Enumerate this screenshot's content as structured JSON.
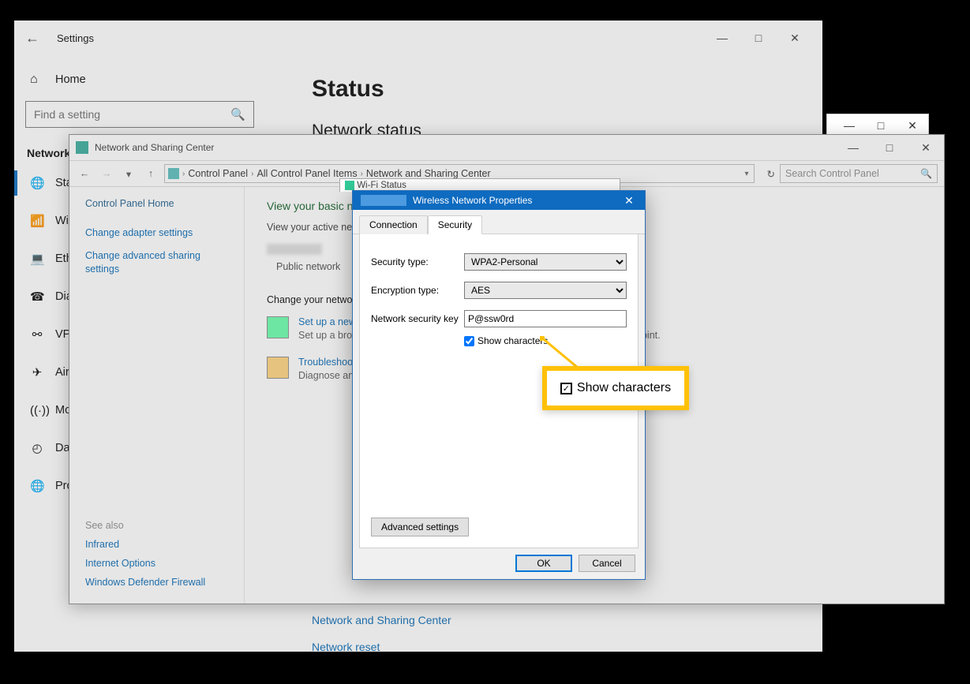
{
  "settings": {
    "window_title": "Settings",
    "home_label": "Home",
    "search_placeholder": "Find a setting",
    "section_title": "Network & Internet",
    "nav_items": [
      {
        "label": "Status",
        "active": true
      },
      {
        "label": "Wi-Fi"
      },
      {
        "label": "Ethernet"
      },
      {
        "label": "Dial-up"
      },
      {
        "label": "VPN"
      },
      {
        "label": "Airplane mode"
      },
      {
        "label": "Mobile hotspot"
      },
      {
        "label": "Data usage"
      },
      {
        "label": "Proxy"
      }
    ],
    "main_heading": "Status",
    "sub_heading": "Network status",
    "link_sharing": "Network and Sharing Center",
    "link_reset": "Network reset"
  },
  "control_panel": {
    "window_title": "Network and Sharing Center",
    "breadcrumb": [
      "Control Panel",
      "All Control Panel Items",
      "Network and Sharing Center"
    ],
    "search_placeholder": "Search Control Panel",
    "left": {
      "home": "Control Panel Home",
      "link1": "Change adapter settings",
      "link2": "Change advanced sharing settings",
      "see_also": "See also",
      "bottom": [
        "Infrared",
        "Internet Options",
        "Windows Defender Firewall"
      ]
    },
    "main": {
      "h1": "View your basic network information and set up connections",
      "sub1": "View your active networks",
      "net_type": "Public network",
      "change_title": "Change your networking settings",
      "task1_link": "Set up a new connection or network",
      "task1_desc": "Set up a broadband, dial-up, or VPN connection; or set up a router or access point.",
      "task2_link": "Troubleshoot problems",
      "task2_desc": "Diagnose and repair network problems, or get troubleshooting information."
    }
  },
  "wifi_status_peek": "Wi-Fi Status",
  "wnp": {
    "title": "Wireless Network Properties",
    "tabs": {
      "connection": "Connection",
      "security": "Security"
    },
    "lbl_sec_type": "Security type:",
    "val_sec_type": "WPA2-Personal",
    "lbl_enc_type": "Encryption type:",
    "val_enc_type": "AES",
    "lbl_key": "Network security key",
    "val_key": "P@ssw0rd",
    "show_chars": "Show characters",
    "adv_btn": "Advanced settings",
    "ok": "OK",
    "cancel": "Cancel"
  },
  "callout_text": "Show characters"
}
